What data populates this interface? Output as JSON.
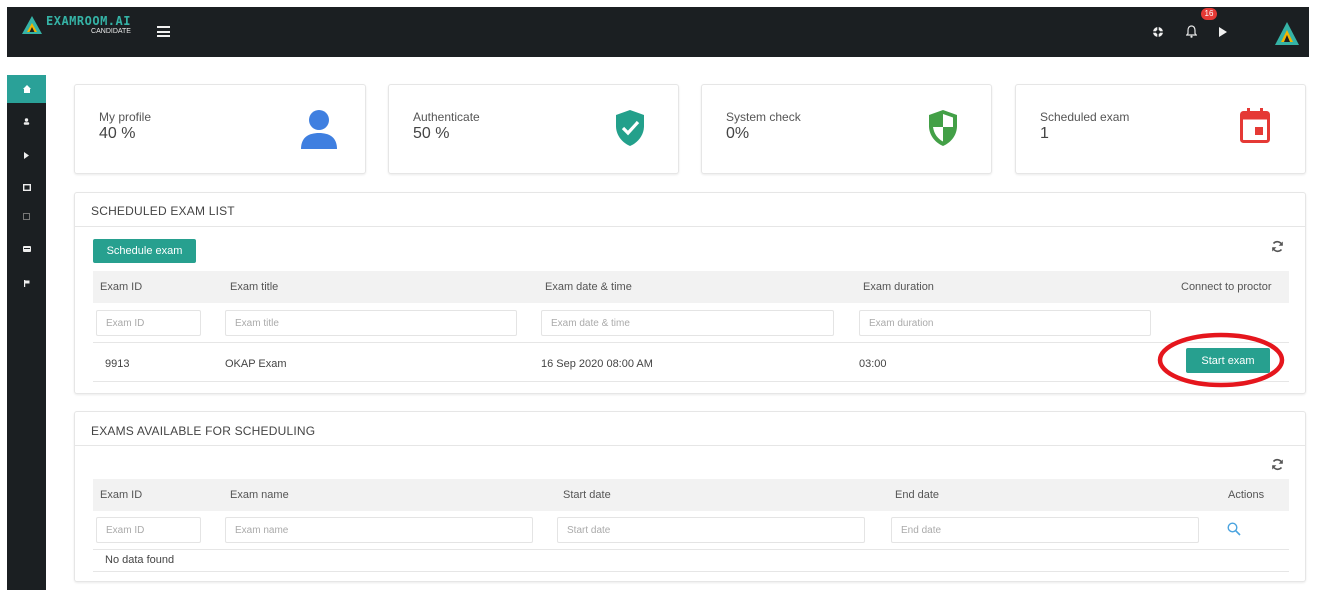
{
  "header": {
    "brand_name": "EXAMROOM.AI",
    "brand_sub": "CANDIDATE",
    "notification_count": "16"
  },
  "stats": [
    {
      "label": "My profile",
      "value": "40 %",
      "icon": "user-icon",
      "color": "#3f7fe0"
    },
    {
      "label": "Authenticate",
      "value": "50 %",
      "icon": "shield-check-icon",
      "color": "#23a08b"
    },
    {
      "label": "System check",
      "value": "0%",
      "icon": "shield-half-icon",
      "color": "#43a047"
    },
    {
      "label": "Scheduled exam",
      "value": "1",
      "icon": "calendar-icon",
      "color": "#e53935"
    }
  ],
  "scheduled": {
    "title": "SCHEDULED EXAM LIST",
    "button": "Schedule exam",
    "columns": [
      "Exam ID",
      "Exam title",
      "Exam date & time",
      "Exam duration",
      "Connect to proctor"
    ],
    "filters": [
      "Exam ID",
      "Exam title",
      "Exam date & time",
      "Exam duration"
    ],
    "rows": [
      {
        "id": "9913",
        "title": "OKAP Exam",
        "datetime": "16 Sep 2020 08:00 AM",
        "duration": "03:00",
        "action": "Start exam"
      }
    ]
  },
  "available": {
    "title": "EXAMS AVAILABLE FOR SCHEDULING",
    "columns": [
      "Exam ID",
      "Exam name",
      "Start date",
      "End date",
      "Actions"
    ],
    "filters": [
      "Exam ID",
      "Exam name",
      "Start date",
      "End date"
    ],
    "empty": "No data found"
  },
  "colors": {
    "accent": "#27a08f",
    "highlight_ring": "#e5161d",
    "dark": "#1b1f22"
  }
}
